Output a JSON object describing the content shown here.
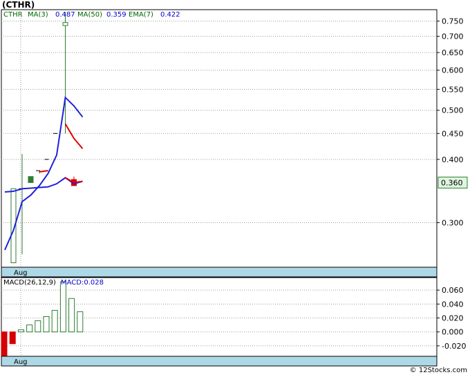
{
  "title": "(CTHR)",
  "footer": "© 12Stocks.com",
  "colors": {
    "grid": "#9a9a9a",
    "axis_band": "#add8e6",
    "bar_up": "#2e7d32",
    "bar_down": "#d50000",
    "ma3": "#1f1fdc",
    "ma50": "#1f1fdc",
    "ema7": "#e00000",
    "macd_up": "#2e7d32",
    "macd_down": "#d50000",
    "legend_text": "#0000cc",
    "legend_label": "#006600",
    "price_label_bg": "#dff5df",
    "price_label_border": "#2e7d32"
  },
  "legend": {
    "symbol": "CTHR",
    "ma3_label": "MA(3)",
    "ma3_value": "0.487",
    "ma50_label": "MA(50)",
    "ma50_value": "0.359",
    "ema7_label": "EMA(7)",
    "ema7_value": "0.422"
  },
  "price_label": "0.360",
  "macd_legend": {
    "label": "MACD(26,12,9)",
    "value": "MACD:0.028"
  },
  "chart_data": [
    {
      "type": "ohlc",
      "x_tick_labels": [
        "Aug"
      ],
      "y_tick_labels": [
        "0.750",
        "0.700",
        "0.650",
        "0.600",
        "0.550",
        "0.500",
        "0.450",
        "0.400",
        "0.300"
      ],
      "y_scale": "log",
      "ylim": [
        0.245,
        0.79
      ],
      "candles": [
        {
          "o": 0.25,
          "h": 0.35,
          "l": 0.25,
          "c": 0.35
        },
        {
          "o": 0.35,
          "h": 0.41,
          "l": 0.26,
          "c": 0.35
        },
        {
          "o": 0.37,
          "h": 0.37,
          "l": 0.36,
          "c": 0.36
        },
        {
          "o": 0.38,
          "h": 0.38,
          "l": 0.375,
          "c": 0.38
        },
        {
          "o": 0.4,
          "h": 0.4,
          "l": 0.4,
          "c": 0.4
        },
        {
          "o": 0.45,
          "h": 0.45,
          "l": 0.45,
          "c": 0.45
        },
        {
          "o": 0.735,
          "h": 0.78,
          "l": 0.45,
          "c": 0.745
        },
        {
          "o": 0.365,
          "h": 0.37,
          "l": 0.355,
          "c": 0.355
        }
      ],
      "ma3": [
        0.265,
        0.29,
        0.33,
        0.34,
        0.355,
        0.375,
        0.408,
        0.53,
        0.51,
        0.485
      ],
      "ema7": [
        null,
        null,
        null,
        null,
        0.378,
        0.38,
        null,
        0.47,
        0.44,
        0.42
      ],
      "ema7_low": [
        null,
        null,
        null,
        null,
        null,
        null,
        null,
        0.368,
        0.36,
        0.362
      ],
      "ma50": [
        0.345,
        0.346,
        0.35,
        0.351,
        0.352,
        0.353,
        0.358,
        0.368,
        0.358,
        0.362
      ]
    },
    {
      "type": "bar",
      "title": "MACD(26,12,9)",
      "x_tick_labels": [
        "Aug"
      ],
      "y_tick_labels": [
        "0.060",
        "0.040",
        "0.020",
        "0.000",
        "-0.020"
      ],
      "ylim": [
        -0.035,
        0.078
      ],
      "values": [
        -0.035,
        -0.017,
        0.003,
        0.01,
        0.016,
        0.022,
        0.031,
        0.072,
        0.048,
        0.029
      ]
    }
  ]
}
